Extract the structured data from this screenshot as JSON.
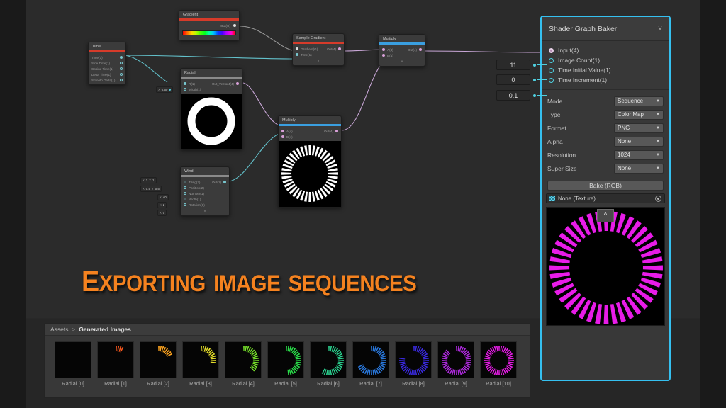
{
  "title_banner": "Exporting image sequences",
  "accent_orange": "#F5821F",
  "selection_blue": "#35C0F0",
  "graph": {
    "nodes": [
      {
        "name": "Time",
        "accent": "#d63b2a",
        "outputs": [
          "Time(1)",
          "Sine Time(1)",
          "Cosine Time(1)",
          "Delta Time(1)",
          "Smooth Delta(1)"
        ],
        "inputs": []
      },
      {
        "name": "Gradient",
        "accent": "#d63b2a",
        "outputs": [
          "Out(G)"
        ],
        "inputs": [],
        "swatch": "rainbow"
      },
      {
        "name": "Sample Gradient",
        "accent": "#d63b2a",
        "inputs": [
          "Gradient(G)",
          "Time(1)"
        ],
        "outputs": [
          "Out(4)"
        ]
      },
      {
        "name": "Multiply",
        "accent": "#3a9fe0",
        "inputs": [
          "A(4)",
          "B(4)"
        ],
        "outputs": [
          "Out(4)"
        ]
      },
      {
        "name": "Radial",
        "accent": "#8a8a8a",
        "inputs": [
          "R(1)",
          "Width(1)"
        ],
        "outputs": [
          "Out_Vector4(4)"
        ],
        "width_value": "0.60"
      },
      {
        "name": "Multiply",
        "accent": "#3a9fe0",
        "inputs": [
          "A(4)",
          "B(4)"
        ],
        "outputs": [
          "Out(4)"
        ]
      },
      {
        "name": "Wind",
        "accent": "#8a8a8a",
        "inputs": [
          "Tiling(2)",
          "Position(2)",
          "Number(1)",
          "Width(1)",
          "Rotation(1)"
        ],
        "outputs": [
          "Out(1)"
        ],
        "values": [
          {
            "label": "Tiling(2)",
            "x": "1",
            "y": "1"
          },
          {
            "label": "Position(2)",
            "x": "0.5",
            "y": "0.5"
          },
          {
            "label": "Number(1)",
            "x": "40"
          },
          {
            "label": "Width(1)",
            "x": "2"
          },
          {
            "label": "Rotation(1)",
            "x": "0"
          }
        ]
      }
    ]
  },
  "baker": {
    "title": "Shader Graph Baker",
    "collapse_icon": "chevron-down",
    "ports": [
      {
        "label": "Input(4)",
        "connected": true
      },
      {
        "label": "Image Count(1)",
        "connected": false
      },
      {
        "label": "Time Initial Value(1)",
        "connected": false
      },
      {
        "label": "Time Increment(1)",
        "connected": false
      }
    ],
    "inputs": [
      {
        "name": "image-count",
        "value": "11"
      },
      {
        "name": "time-initial-value",
        "value": "0"
      },
      {
        "name": "time-increment",
        "value": "0.1"
      }
    ],
    "settings": [
      {
        "label": "Mode",
        "value": "Sequence"
      },
      {
        "label": "Type",
        "value": "Color Map"
      },
      {
        "label": "Format",
        "value": "PNG"
      },
      {
        "label": "Alpha",
        "value": "None"
      },
      {
        "label": "Resolution",
        "value": "1024"
      },
      {
        "label": "Super Size",
        "value": "None"
      }
    ],
    "bake_button": "Bake (RGB)",
    "texture_field": "None (Texture)",
    "preview_color": "#e81ce8",
    "preview_segments": 40
  },
  "assets": {
    "breadcrumb_root": "Assets",
    "breadcrumb_sep": ">",
    "breadcrumb_current": "Generated Images",
    "items": [
      {
        "label": "Radial [0]",
        "color": "#000000",
        "fill": 0.0
      },
      {
        "label": "Radial [1]",
        "color": "#ff5a1e",
        "fill": 0.09
      },
      {
        "label": "Radial [2]",
        "color": "#ffa41e",
        "fill": 0.19
      },
      {
        "label": "Radial [3]",
        "color": "#e8e02a",
        "fill": 0.29
      },
      {
        "label": "Radial [4]",
        "color": "#76e02a",
        "fill": 0.39
      },
      {
        "label": "Radial [5]",
        "color": "#2ae04a",
        "fill": 0.49
      },
      {
        "label": "Radial [6]",
        "color": "#2ad08e",
        "fill": 0.59
      },
      {
        "label": "Radial [7]",
        "color": "#2a7ae0",
        "fill": 0.69
      },
      {
        "label": "Radial [8]",
        "color": "#3a2ae0",
        "fill": 0.79
      },
      {
        "label": "Radial [9]",
        "color": "#b02ae0",
        "fill": 0.89
      },
      {
        "label": "Radial [10]",
        "color": "#e81ce8",
        "fill": 1.0
      }
    ]
  }
}
